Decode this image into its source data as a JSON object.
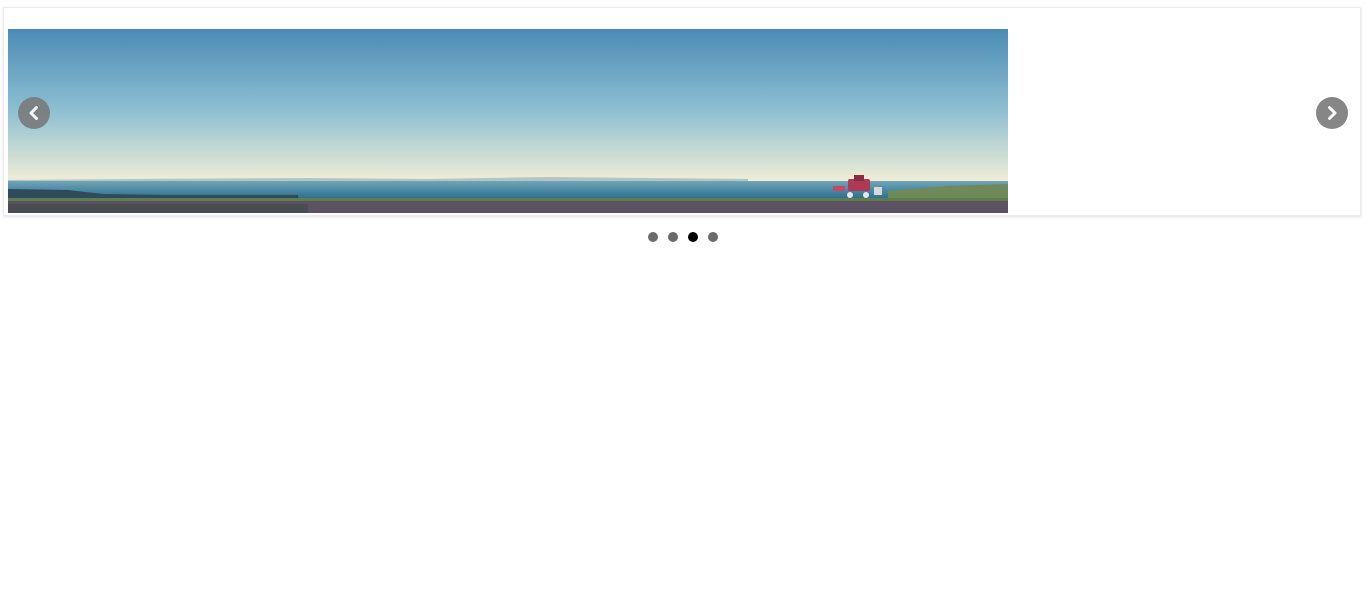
{
  "carousel": {
    "slides_count": 4,
    "active_slide_index": 2,
    "slide_image": {
      "icon": "beach-landscape-image",
      "sky_top_color": "#4a8bb5",
      "sky_horizon_color": "#f6f0d6",
      "sea_color": "#3b7e98",
      "ground_color": "#5a5260"
    },
    "prev_arrow": {
      "icon": "chevron-left-icon",
      "color": "#7a7a7a"
    },
    "next_arrow": {
      "icon": "chevron-right-icon",
      "color": "#7a7a7a"
    },
    "dots": [
      {
        "active": false
      },
      {
        "active": false
      },
      {
        "active": true
      },
      {
        "active": false
      }
    ]
  }
}
